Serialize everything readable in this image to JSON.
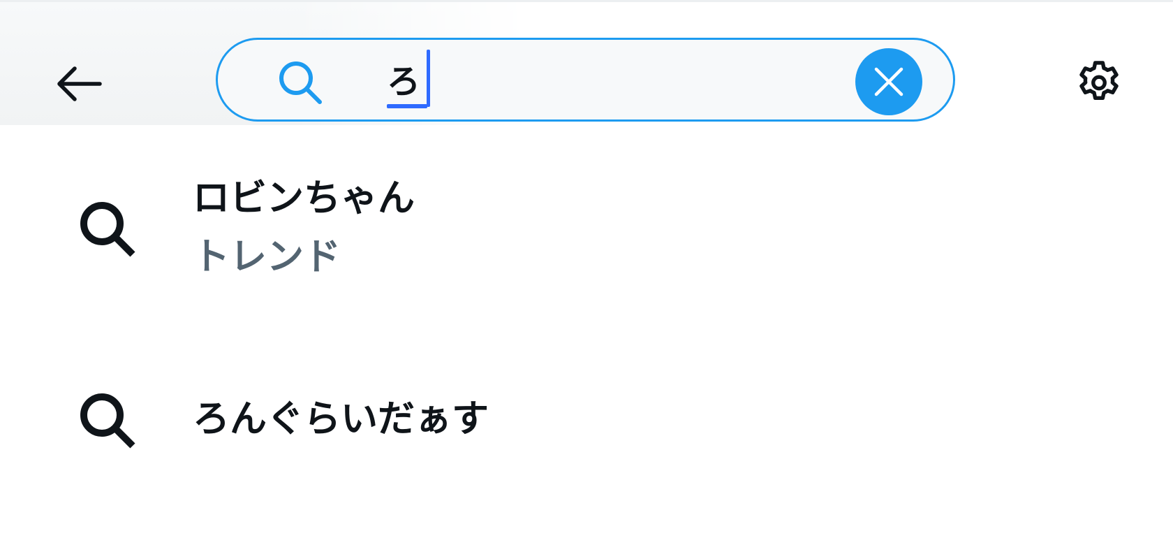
{
  "header": {
    "back_icon": "arrow-left-icon",
    "settings_icon": "gear-icon"
  },
  "search": {
    "icon": "search-icon",
    "value": "ろ",
    "clear_icon": "close-icon"
  },
  "results": [
    {
      "icon": "search-icon",
      "title": "ロビンちゃん",
      "subtitle": "トレンド"
    },
    {
      "icon": "search-icon",
      "title": "ろんぐらいだぁす",
      "subtitle": ""
    }
  ],
  "colors": {
    "accent": "#1d9bf0",
    "text_primary": "#0f1419",
    "text_secondary": "#536471",
    "ime_caret": "#2f6bff"
  }
}
